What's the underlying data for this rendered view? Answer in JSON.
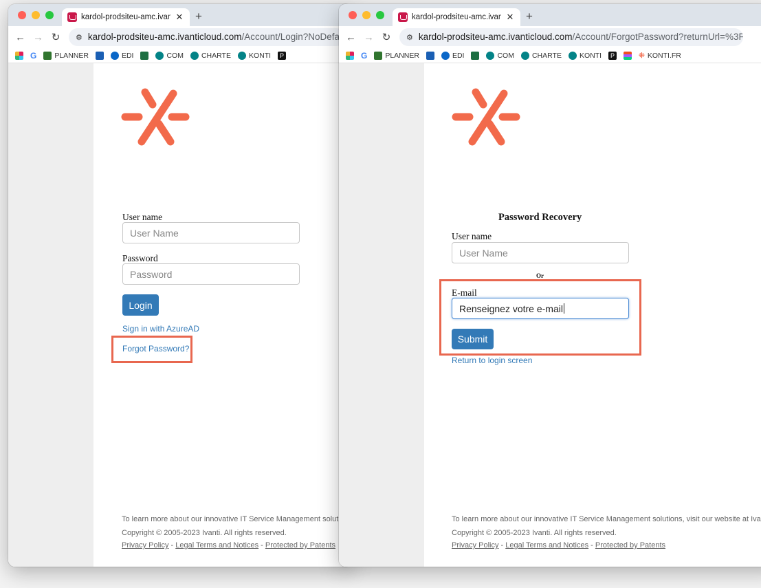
{
  "login_window": {
    "tab_title": "kardol-prodsiteu-amc.ivanticl",
    "url_host": "kardol-prodsiteu-amc.ivanticloud.com",
    "url_path": "/Account/Login?NoDefaultPr",
    "bookmarks": [
      "G",
      "PLANNER",
      "EDI",
      "COM",
      "CHARTE",
      "KONTI",
      "P"
    ],
    "username_label": "User name",
    "username_placeholder": "User Name",
    "password_label": "Password",
    "password_placeholder": "Password",
    "login_button": "Login",
    "azure_link": "Sign in with AzureAD",
    "forgot_link": "Forgot Password?",
    "footer_line1": "To learn more about our innovative IT Service Management solut",
    "footer_line2": "Copyright © 2005-2023 Ivanti. All rights reserved.",
    "privacy": "Privacy Policy",
    "legal": "Legal Terms and Notices",
    "patents": "Protected by Patents",
    "sep": " - "
  },
  "recovery_window": {
    "tab_title": "kardol-prodsiteu-amc.ivanticl",
    "url_host": "kardol-prodsiteu-amc.ivanticloud.com",
    "url_path": "/Account/ForgotPassword?returnUrl=%3F...",
    "bookmarks": [
      "G",
      "PLANNER",
      "EDI",
      "COM",
      "CHARTE",
      "KONTI",
      "P",
      "KONTI.FR"
    ],
    "heading": "Password Recovery",
    "username_label": "User name",
    "username_placeholder": "User Name",
    "or_text": "Or",
    "email_label": "E-mail",
    "email_value": "Renseignez votre e-mail",
    "submit_button": "Submit",
    "return_link": "Return to login screen",
    "footer_line1": "To learn more about our innovative IT Service Management solutions, visit our website at Iva",
    "footer_line2": "Copyright © 2005-2023 Ivanti. All rights reserved.",
    "privacy": "Privacy Policy",
    "legal": "Legal Terms and Notices",
    "patents": "Protected by Patents",
    "sep": " - "
  },
  "colors": {
    "brand_orange": "#f26a4b",
    "button_blue": "#337ab7",
    "highlight_red": "#e8674f"
  }
}
